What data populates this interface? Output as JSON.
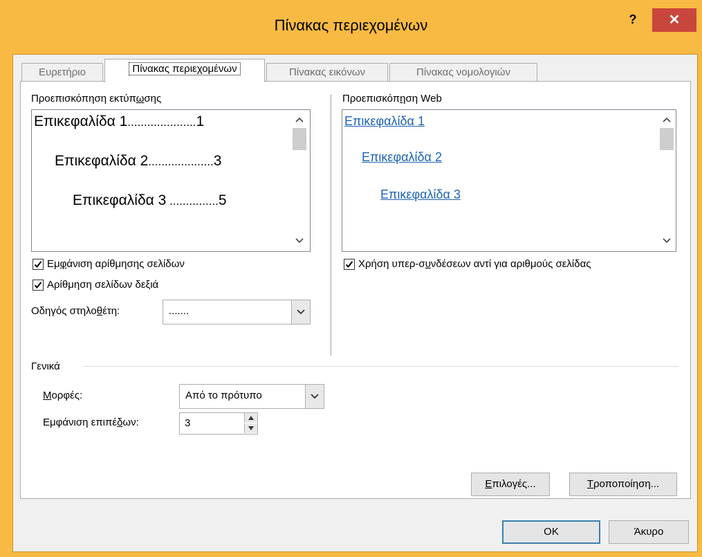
{
  "window": {
    "title": "Πίνακας περιεχομένων",
    "help_label": "?",
    "close_label": "✕"
  },
  "tabs": [
    {
      "label": "Ευρετήριο",
      "active": false
    },
    {
      "label": "Πίνακας περιεχομένων",
      "active": true
    },
    {
      "label": "Πίνακας εικόνων",
      "active": false
    },
    {
      "label": "Πίνακας νομολογιών",
      "active": false
    }
  ],
  "print_preview": {
    "label_pre": "Προεπισκόπηση εκτύπ",
    "label_u": "ω",
    "label_post": "σης",
    "lines": [
      {
        "text": "Επικεφαλίδα 1",
        "page": "1"
      },
      {
        "text": "Επικεφαλίδα 2",
        "page": "3"
      },
      {
        "text": "Επικεφαλίδα 3",
        "page": "5"
      }
    ],
    "leader": "......................"
  },
  "web_preview": {
    "label_pre": "Προεπισκόπ",
    "label_u": "η",
    "label_post": "ση Web",
    "links": [
      "Επικεφαλίδα 1",
      "Επικεφαλίδα 2",
      "Επικεφαλίδα 3"
    ]
  },
  "options": {
    "show_page_numbers": {
      "pre": "Εμ",
      "u": "φ",
      "post": "άνιση αρίθμησης σελίδων",
      "checked": true
    },
    "right_align": {
      "pre": "Αρίθμηση σελίδων δεξιά",
      "u": "",
      "post": "",
      "checked": true
    },
    "tab_leader": {
      "pre": "Οδηγός στηλο",
      "u": "θ",
      "post": "έτη:",
      "value": "......."
    },
    "use_hyperlinks": {
      "pre": "Χρήση υπερ-σ",
      "u": "υ",
      "post": "νδέσεων αντί για αριθμούς σελίδας",
      "checked": true
    }
  },
  "general": {
    "section_label": "Γενικά",
    "formats": {
      "pre": "",
      "u": "Μ",
      "post": "ορφές:",
      "value": "Από το πρότυπο"
    },
    "levels": {
      "pre": "Εμφάνιση επιπέ",
      "u": "δ",
      "post": "ων:",
      "value": "3"
    }
  },
  "buttons": {
    "options": {
      "pre": "",
      "u": "Ε",
      "post": "πιλογές..."
    },
    "modify": {
      "pre": "",
      "u": "Τ",
      "post": "ροποποίηση..."
    },
    "ok": "OK",
    "cancel": "Άκυρο"
  }
}
